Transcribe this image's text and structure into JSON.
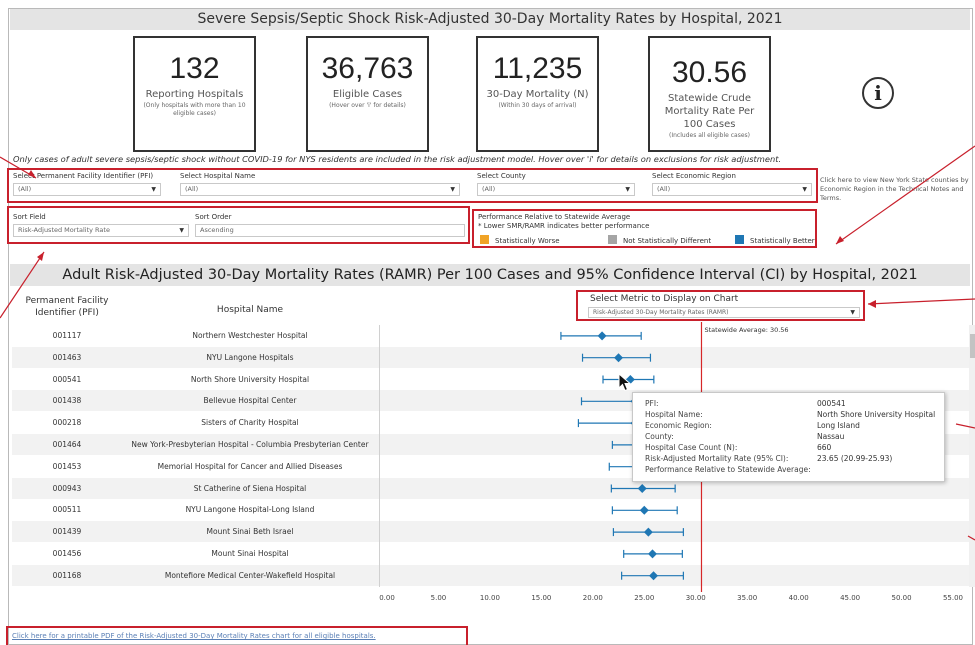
{
  "page": {
    "title": "Severe Sepsis/Septic Shock Risk-Adjusted 30-Day Mortality Rates by Hospital, 2021"
  },
  "kpis": [
    {
      "value": "132",
      "label": "Reporting Hospitals",
      "note": "(Only hospitals with more than 10 eligible cases)"
    },
    {
      "value": "36,763",
      "label": "Eligible Cases",
      "note": "(Hover over 'i' for details)"
    },
    {
      "value": "11,235",
      "label": "30-Day Mortality (N)",
      "note": "(Within 30 days of arrival)"
    },
    {
      "value": "30.56",
      "label": "Statewide Crude Mortality Rate Per 100 Cases",
      "note": "(Includes all eligible cases)"
    }
  ],
  "info_icon": "info-icon",
  "note": "Only cases of adult severe sepsis/septic shock without COVID-19 for NYS residents are included in the risk adjustment model. Hover over 'i' for details on exclusions for risk adjustment.",
  "filters": {
    "pfi": {
      "label": "Select Permanent Facility Identifier (PFI)",
      "value": "(All)"
    },
    "hospital": {
      "label": "Select Hospital Name",
      "value": "(All)"
    },
    "county": {
      "label": "Select County",
      "value": "(All)"
    },
    "region": {
      "label": "Select Economic Region",
      "value": "(All)"
    },
    "region_note": "Click here to view New York State counties by Economic Region in the Technical Notes and Terms."
  },
  "sort": {
    "field_label": "Sort Field",
    "field_value": "Risk-Adjusted Mortality Rate",
    "order_label": "Sort Order",
    "order_value": "Ascending"
  },
  "performance": {
    "title": "Performance Relative to Statewide Average",
    "subtitle": "* Lower SMR/RAMR indicates better performance",
    "legend": [
      {
        "label": "Statistically Worse",
        "color": "#f0a326"
      },
      {
        "label": "Not Statistically Different",
        "color": "#a5a5a5"
      },
      {
        "label": "Statistically Better",
        "color": "#1f77b4"
      }
    ]
  },
  "section_title": "Adult Risk-Adjusted 30-Day Mortality Rates (RAMR) Per 100 Cases and 95% Confidence Interval (CI)  by Hospital, 2021",
  "table": {
    "col_pfi": "Permanent Facility Identifier (PFI)",
    "col_name": "Hospital Name",
    "metric_label": "Select Metric to Display on Chart",
    "metric_value": "Risk-Adjusted 30-Day Mortality Rates (RAMR)",
    "rows": [
      {
        "pfi": "001117",
        "name": "Northern Westchester Hospital"
      },
      {
        "pfi": "001463",
        "name": "NYU Langone Hospitals"
      },
      {
        "pfi": "000541",
        "name": "North Shore University Hospital"
      },
      {
        "pfi": "001438",
        "name": "Bellevue Hospital Center"
      },
      {
        "pfi": "000218",
        "name": "Sisters of Charity Hospital"
      },
      {
        "pfi": "001464",
        "name": "New York-Presbyterian Hospital - Columbia Presbyterian Center"
      },
      {
        "pfi": "001453",
        "name": "Memorial Hospital for Cancer and Allied Diseases"
      },
      {
        "pfi": "000943",
        "name": "St Catherine of Siena Hospital"
      },
      {
        "pfi": "000511",
        "name": "NYU Langone Hospital-Long Island"
      },
      {
        "pfi": "001439",
        "name": "Mount Sinai Beth Israel"
      },
      {
        "pfi": "001456",
        "name": "Mount Sinai Hospital"
      },
      {
        "pfi": "001168",
        "name": "Montefiore Medical Center-Wakefield Hospital"
      }
    ]
  },
  "chart_data": {
    "type": "scatter",
    "xlim": [
      0,
      55
    ],
    "ticks": [
      "0.00",
      "5.00",
      "10.00",
      "15.00",
      "20.00",
      "25.00",
      "30.00",
      "35.00",
      "40.00",
      "45.00",
      "50.00",
      "55.00"
    ],
    "reference_value": 30.56,
    "reference_label": "Statewide Average: 30.56",
    "point_color": "#1f77b4",
    "reference_color": "#d62728",
    "points": [
      {
        "pfi": "001117",
        "value": 20.9,
        "lower": 16.9,
        "upper": 24.7
      },
      {
        "pfi": "001463",
        "value": 22.5,
        "lower": 19.0,
        "upper": 25.6
      },
      {
        "pfi": "000541",
        "value": 23.65,
        "lower": 20.99,
        "upper": 25.93
      },
      {
        "pfi": "001438",
        "value": 24.1,
        "lower": 18.9,
        "upper": 29.0
      },
      {
        "pfi": "000218",
        "value": 24.1,
        "lower": 18.6,
        "upper": 29.2
      },
      {
        "pfi": "001464",
        "value": 24.4,
        "lower": 21.9,
        "upper": 27.4
      },
      {
        "pfi": "001453",
        "value": 24.5,
        "lower": 21.6,
        "upper": 27.3
      },
      {
        "pfi": "000943",
        "value": 24.8,
        "lower": 21.8,
        "upper": 28.0
      },
      {
        "pfi": "000511",
        "value": 25.0,
        "lower": 21.9,
        "upper": 28.2
      },
      {
        "pfi": "001439",
        "value": 25.4,
        "lower": 22.0,
        "upper": 28.8
      },
      {
        "pfi": "001456",
        "value": 25.8,
        "lower": 23.0,
        "upper": 28.7
      },
      {
        "pfi": "001168",
        "value": 25.9,
        "lower": 22.8,
        "upper": 28.8
      }
    ]
  },
  "tooltip": {
    "rows": [
      {
        "key": "PFI:",
        "value": "000541"
      },
      {
        "key": "Hospital Name:",
        "value": "North Shore University Hospital"
      },
      {
        "key": "Economic Region:",
        "value": "Long Island"
      },
      {
        "key": "County:",
        "value": "Nassau"
      },
      {
        "key": "Hospital Case Count (N):",
        "value": "660"
      },
      {
        "key": "Risk-Adjusted Mortality Rate (95% CI):",
        "value": "23.65 (20.99-25.93)"
      },
      {
        "key": "Performance Relative to Statewide Average:",
        "value": ""
      }
    ]
  },
  "footer": {
    "link": "Click here for a printable PDF of the Risk-Adjusted 30-Day Mortality Rates chart for all eligible hospitals."
  }
}
